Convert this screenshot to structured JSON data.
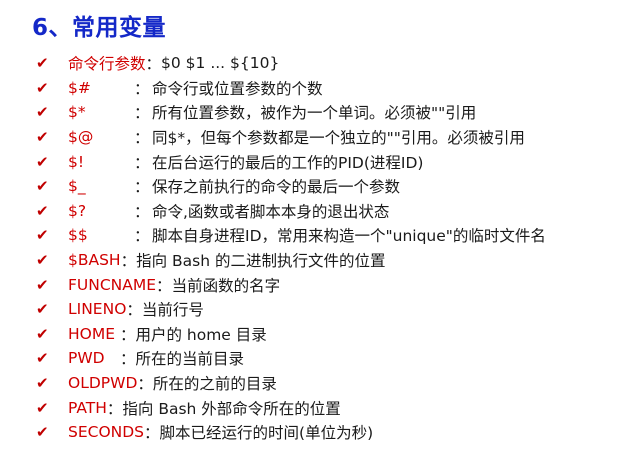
{
  "heading": "6、常用变量",
  "icon": "checkmark-icon",
  "colors": {
    "heading": "#1428c8",
    "term": "#d00000",
    "check": "#c00000",
    "text": "#1a1a1a"
  },
  "items": [
    {
      "term": "命令行参数",
      "sep": "：",
      "desc": "$0 $1 ... ${10}"
    },
    {
      "term": "$#",
      "sep": "：",
      "desc": "命令行或位置参数的个数"
    },
    {
      "term": "$*",
      "sep": "：",
      "desc": "所有位置参数，被作为一个单词。必须被\"\"引用"
    },
    {
      "term": "$@",
      "sep": "：",
      "desc": "同$*，但每个参数都是一个独立的\"\"引用。必须被引用"
    },
    {
      "term": "$!",
      "sep": "：",
      "desc": "在后台运行的最后的工作的PID(进程ID)"
    },
    {
      "term": "$_",
      "sep": "：",
      "desc": "保存之前执行的命令的最后一个参数"
    },
    {
      "term": "$?",
      "sep": "：",
      "desc": "命令,函数或者脚本本身的退出状态"
    },
    {
      "term": "$$",
      "sep": "：",
      "desc": "脚本自身进程ID，常用来构造一个\"unique\"的临时文件名"
    },
    {
      "term": "$BASH",
      "sep": "：",
      "desc": "指向 Bash 的二进制执行文件的位置"
    },
    {
      "term": "FUNCNAME",
      "sep": "：",
      "desc": "当前函数的名字"
    },
    {
      "term": "LINENO",
      "sep": "：",
      "desc": "当前行号"
    },
    {
      "term": "HOME ",
      "sep": "：",
      "desc": "用户的 home 目录"
    },
    {
      "term": "PWD ",
      "sep": "：",
      "desc": "所在的当前目录"
    },
    {
      "term": "OLDPWD",
      "sep": "：",
      "desc": "所在的之前的目录"
    },
    {
      "term": "PATH",
      "sep": "：",
      "desc": "指向 Bash 外部命令所在的位置"
    },
    {
      "term": "SECONDS",
      "sep": "：",
      "desc": "脚本已经运行的时间(单位为秒)"
    }
  ]
}
